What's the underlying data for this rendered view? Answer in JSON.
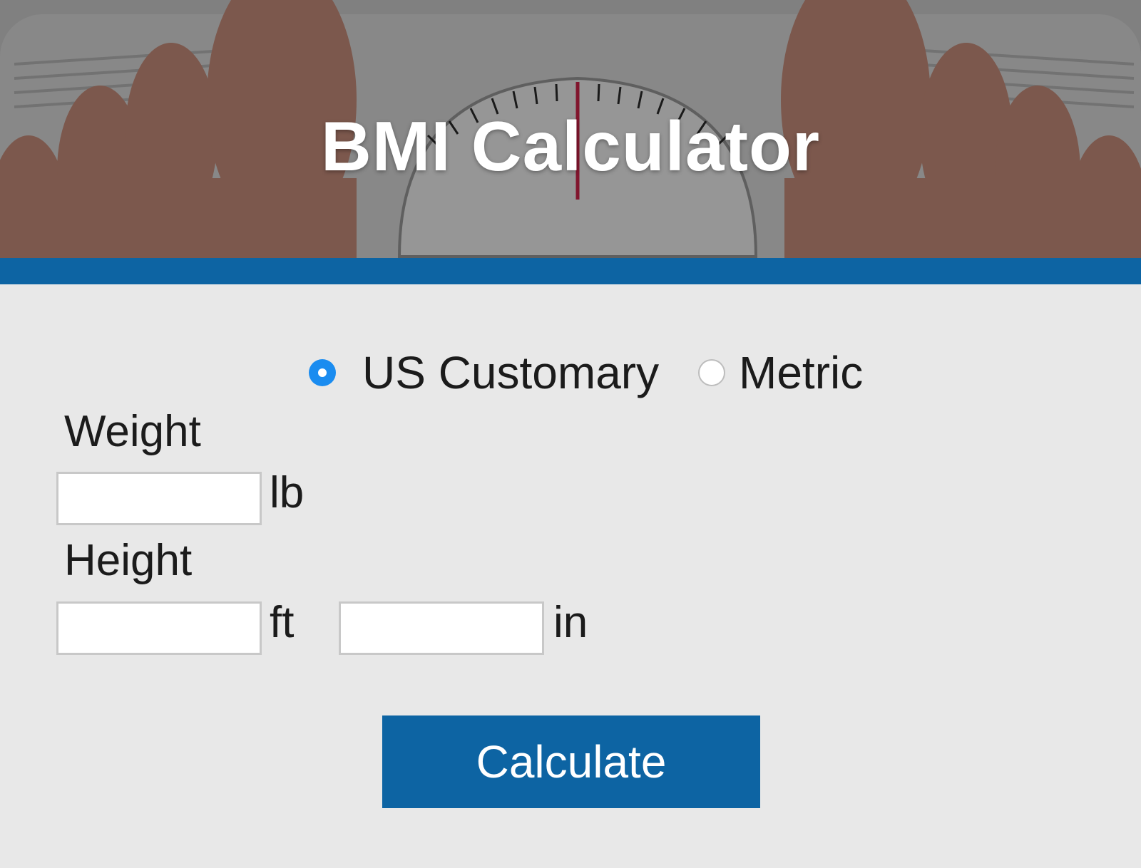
{
  "header": {
    "title": "BMI Calculator",
    "background_image": "bathroom-scale-feet-photo"
  },
  "colors": {
    "accent": "#0d64a3",
    "radio_selected": "#1a8cf0",
    "page_background": "#e8e8e8"
  },
  "units": {
    "options": [
      {
        "label": "US Customary",
        "selected": true
      },
      {
        "label": "Metric",
        "selected": false
      }
    ]
  },
  "form": {
    "weight": {
      "label": "Weight",
      "value": "",
      "unit": "lb"
    },
    "height": {
      "label": "Height",
      "feet_value": "",
      "feet_unit": "ft",
      "inches_value": "",
      "inches_unit": "in"
    },
    "submit_label": "Calculate"
  }
}
